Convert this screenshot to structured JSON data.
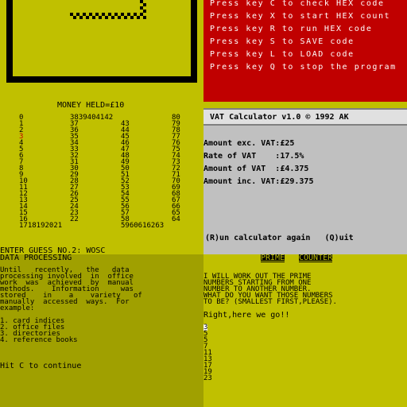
{
  "colors": {
    "yellow": "#c0c000",
    "red": "#c00000",
    "grey": "#c0c0c0",
    "olive": "#a0a000",
    "black": "#000000",
    "white": "#ffffff",
    "highlight": "#c00000"
  },
  "hex_menu": {
    "lines": [
      "Press key C to check HEX code",
      "Press key X to start HEX count",
      "Press key R to run HEX code",
      "Press key S to SAVE code",
      "Press key L to LOAD code",
      "Press key Q to stop the program"
    ]
  },
  "guess_game": {
    "money": "MONEY HELD=£10",
    "rows": [
      [
        "0",
        "3839404142",
        "80"
      ],
      [
        "1",
        "37",
        "43",
        "79"
      ],
      [
        "2",
        "36",
        "44",
        "78"
      ],
      [
        "3",
        "35",
        "45",
        "77"
      ],
      [
        "4",
        "34",
        "46",
        "76"
      ],
      [
        "5",
        "33",
        "47",
        "75"
      ],
      [
        "6",
        "32",
        "48",
        "74"
      ],
      [
        "7",
        "31",
        "49",
        "73"
      ],
      [
        "8",
        "30",
        "50",
        "72"
      ],
      [
        "9",
        "29",
        "51",
        "71"
      ],
      [
        "10",
        "28",
        "52",
        "70"
      ],
      [
        "11",
        "27",
        "53",
        "69"
      ],
      [
        "12",
        "26",
        "54",
        "68"
      ],
      [
        "13",
        "25",
        "55",
        "67"
      ],
      [
        "14",
        "24",
        "56",
        "66"
      ],
      [
        "15",
        "23",
        "57",
        "65"
      ],
      [
        "16",
        "22",
        "58",
        "64"
      ],
      [
        "1718192021",
        "5960616263"
      ]
    ],
    "prompt": "ENTER GUESS NO.2: WOSC"
  },
  "vat": {
    "title": "VAT Calculator v1.0 © 1992 AK",
    "lines": [
      "Amount exc. VAT:£25",
      "Rate of VAT    :17.5%",
      "Amount of VAT  :£4.375",
      "Amount inc. VAT:£29.375"
    ],
    "options": "(R)un calculator again   (Q)uit"
  },
  "data_processing": {
    "title": "DATA PROCESSING",
    "para": [
      "Until   recently,   the   data",
      "processing involved  in  office",
      "work  was  achieved  by  manual",
      "methods.    Information     was",
      "stored    in    a    variety   of",
      "manually  accessed  ways.  For",
      "example:"
    ],
    "list": [
      "1. card indices",
      "2. office files",
      "3. directories",
      "4. reference books"
    ],
    "continue": "Hit C to continue"
  },
  "prime": {
    "title_1": "PRIME",
    "title_2": "COUNTER",
    "intro": [
      "I WILL WORK OUT THE PRIME",
      "NUMBERS STARTING FROM ONE",
      "NUMBER TO ANOTHER NUMBER.",
      "WHAT DO YOU WANT THOSE NUMBERS",
      "TO BE? (SMALLEST FIRST,PLEASE)."
    ],
    "go": "Right,here we go!!",
    "numbers": [
      "3",
      "5",
      "5",
      "7",
      "11",
      "13",
      "17",
      "19",
      "23"
    ]
  }
}
